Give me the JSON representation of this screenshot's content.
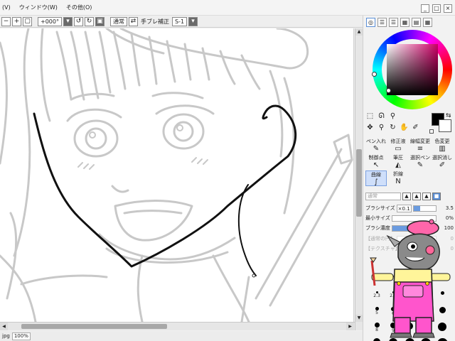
{
  "menu": {
    "items": [
      "(V)",
      "ウィンドウ(W)",
      "その他(O)"
    ],
    "window_buttons": [
      "_",
      "□",
      "×"
    ]
  },
  "toolbar": {
    "rotation": "+000°",
    "blend_mode": "通常",
    "stabilizer_label": "手ブレ補正",
    "stabilizer_value": "S-1"
  },
  "status": {
    "file": "jpg",
    "zoom": "100%"
  },
  "panel": {
    "color_tabs": [
      "◎",
      "☰",
      "☰",
      "▦",
      "▤",
      "▦"
    ],
    "foreground_color": "#000000",
    "background_color": "#ffffff",
    "hue_color": "#cc0066",
    "brushes": [
      {
        "label": "ペン入れ",
        "glyph": "✎"
      },
      {
        "label": "修正液",
        "glyph": "▭"
      },
      {
        "label": "線幅変更",
        "glyph": "≡"
      },
      {
        "label": "色変更",
        "glyph": "▥"
      },
      {
        "label": "制御点",
        "glyph": "↖"
      },
      {
        "label": "筆圧",
        "glyph": "◭"
      },
      {
        "label": "選択ペン",
        "glyph": "✎"
      },
      {
        "label": "選択消し",
        "glyph": "✐"
      },
      {
        "label": "曲線",
        "glyph": "∫"
      },
      {
        "label": "折線",
        "glyph": "N"
      },
      {
        "label": "",
        "glyph": ""
      },
      {
        "label": "",
        "glyph": ""
      }
    ],
    "mode_field": "通常",
    "brush_size_label": "ブラシサイズ",
    "brush_size_multiplier": "×0.1",
    "brush_size_value": "3.5",
    "min_size_label": "最小サイズ",
    "min_size_value": "0%",
    "density_label": "ブラシ濃度",
    "density_value": "100",
    "texture_placeholder": "【通常の円】",
    "texture_placeholder2": "【テクスチャ】",
    "disabled_value": "0",
    "sizes": [
      "0.7",
      "0.8",
      "",
      "",
      "",
      "2.3",
      "2.6",
      "",
      "",
      "",
      "5",
      "6",
      "",
      "",
      "",
      "8",
      "9",
      "",
      "",
      "",
      "10",
      "",
      "",
      "",
      ""
    ]
  }
}
